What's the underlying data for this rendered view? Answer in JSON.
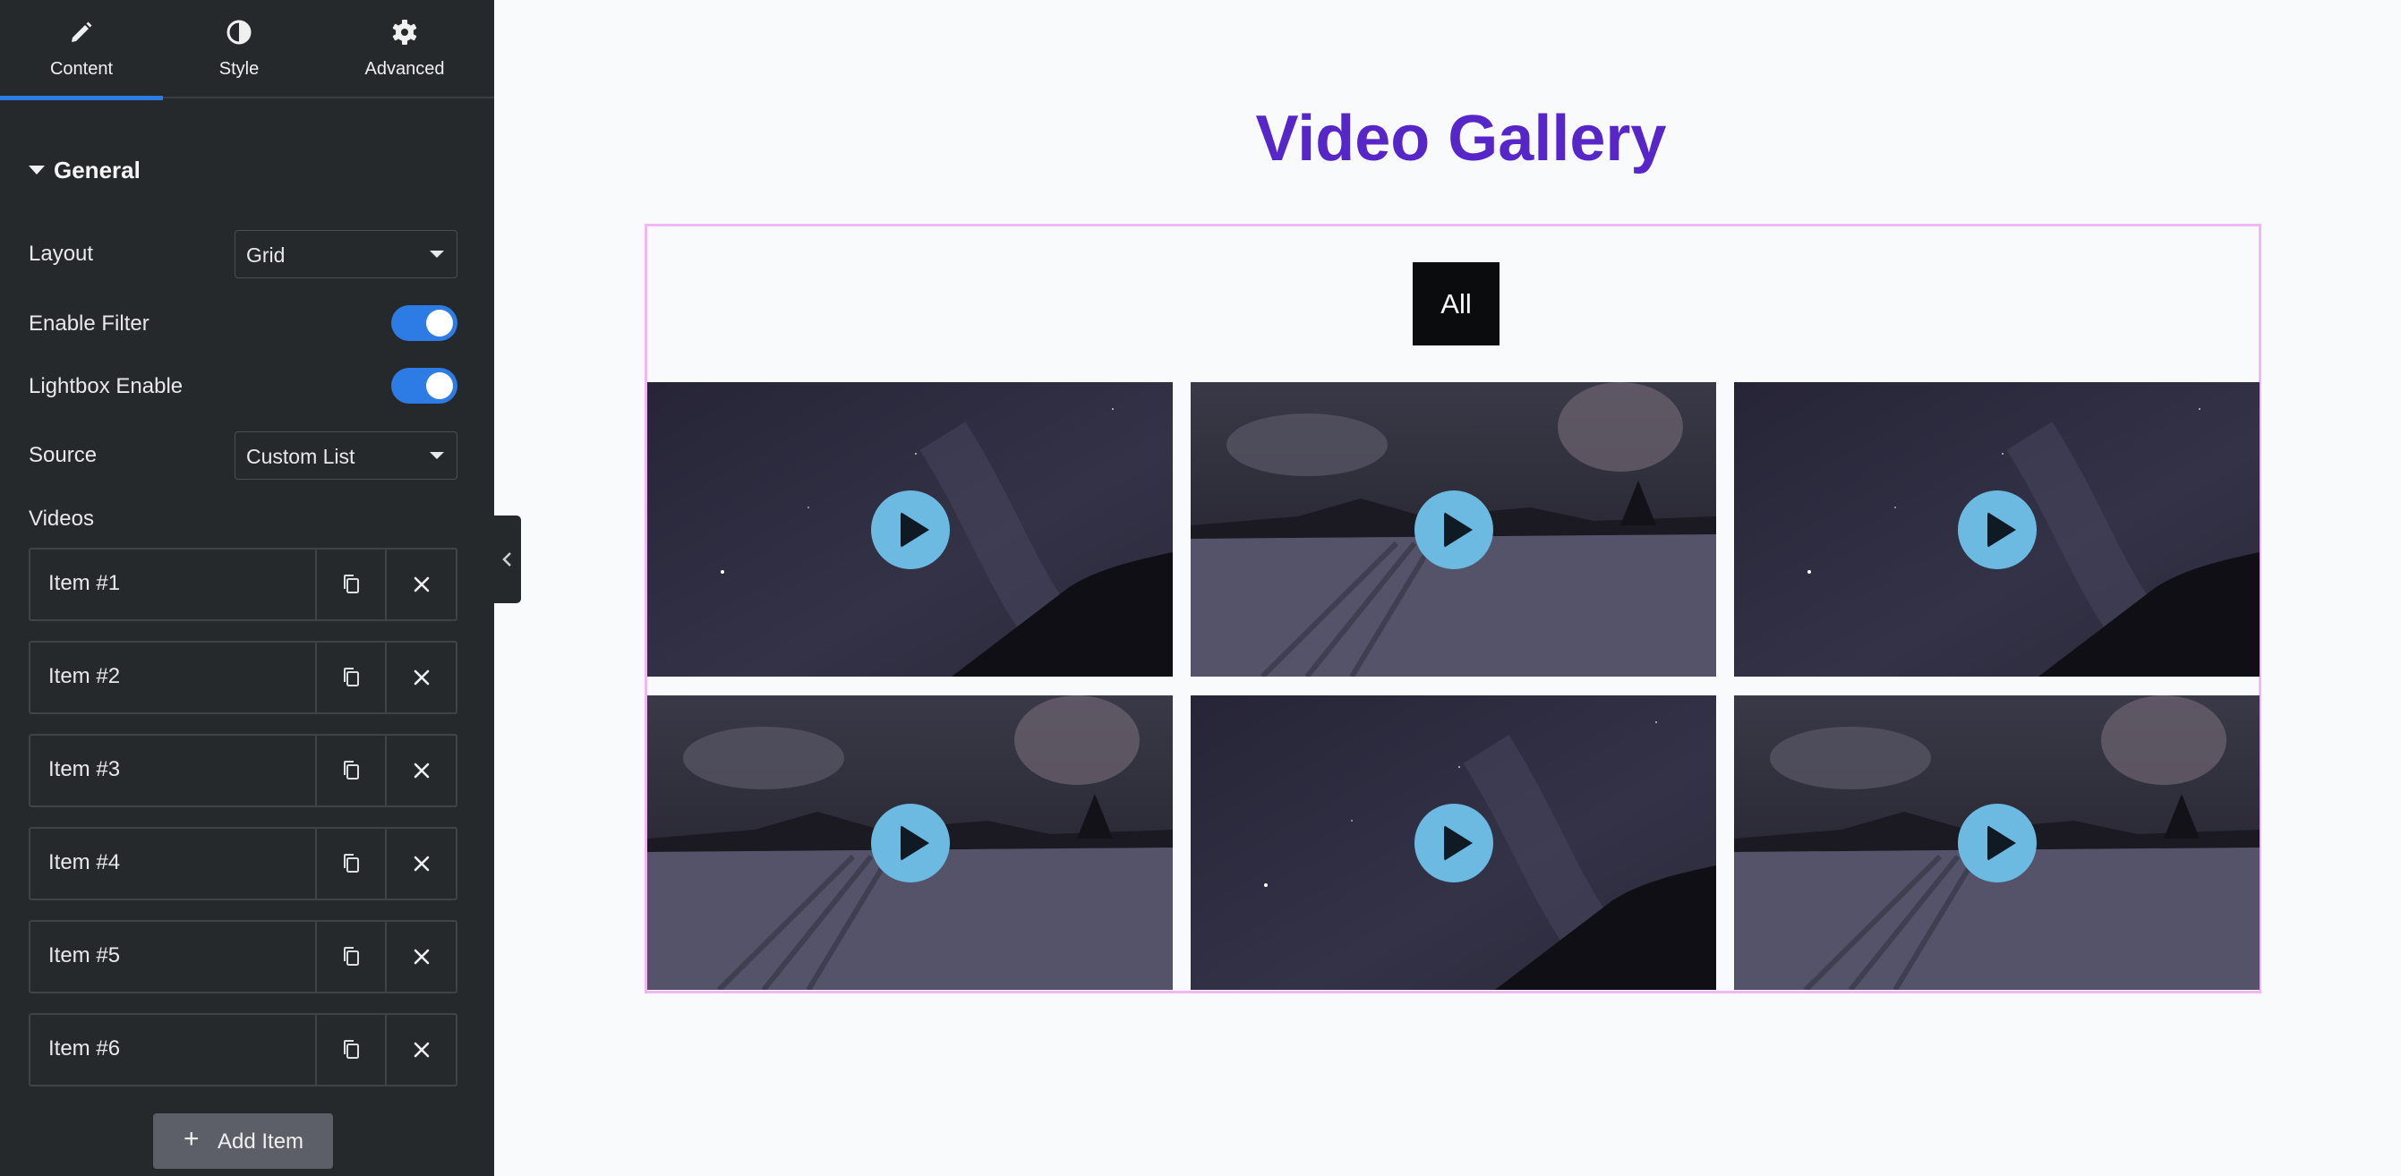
{
  "sidebar": {
    "tabs": [
      {
        "label": "Content",
        "icon": "pencil-icon",
        "active": true
      },
      {
        "label": "Style",
        "icon": "contrast-icon",
        "active": false
      },
      {
        "label": "Advanced",
        "icon": "gear-icon",
        "active": false
      }
    ],
    "section": {
      "title": "General",
      "expanded": true
    },
    "layout": {
      "label": "Layout",
      "value": "Grid"
    },
    "enable_filter": {
      "label": "Enable Filter",
      "on": true
    },
    "lightbox": {
      "label": "Lightbox Enable",
      "on": true
    },
    "source": {
      "label": "Source",
      "value": "Custom List"
    },
    "videos": {
      "label": "Videos",
      "items": [
        "Item #1",
        "Item #2",
        "Item #3",
        "Item #4",
        "Item #5",
        "Item #6"
      ]
    },
    "add_item_label": "Add Item",
    "accent_color": "#2d7ce6"
  },
  "preview": {
    "heading": "Video Gallery",
    "heading_color": "#5726c9",
    "filters": [
      "All"
    ],
    "videos": [
      {
        "thumb": "mountain-night"
      },
      {
        "thumb": "road-clouds"
      },
      {
        "thumb": "mountain-night"
      },
      {
        "thumb": "road-clouds"
      },
      {
        "thumb": "mountain-night"
      },
      {
        "thumb": "road-clouds"
      }
    ],
    "play_color": "#6cb9e2"
  }
}
